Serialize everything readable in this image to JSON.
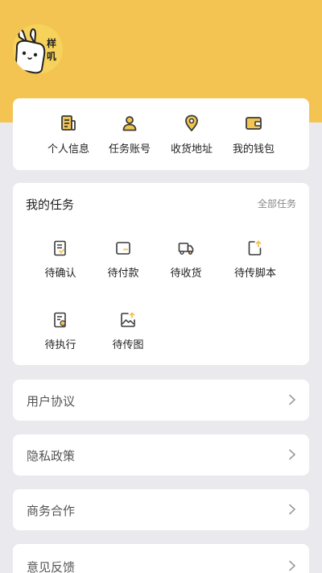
{
  "profile": {
    "avatar_text": "样叽",
    "avatar_text_line1": "样",
    "avatar_text_line2": "叽"
  },
  "quick_actions": [
    {
      "label": "个人信息",
      "icon": "document-icon"
    },
    {
      "label": "任务账号",
      "icon": "user-icon"
    },
    {
      "label": "收货地址",
      "icon": "location-pin-icon"
    },
    {
      "label": "我的钱包",
      "icon": "wallet-icon"
    }
  ],
  "tasks": {
    "title": "我的任务",
    "all_label": "全部任务",
    "items": [
      {
        "label": "待确认",
        "icon": "confirm-doc-icon"
      },
      {
        "label": "待付款",
        "icon": "payment-card-icon"
      },
      {
        "label": "待收货",
        "icon": "truck-icon"
      },
      {
        "label": "待传脚本",
        "icon": "upload-script-icon"
      },
      {
        "label": "待执行",
        "icon": "execute-doc-icon"
      },
      {
        "label": "待传图",
        "icon": "upload-image-icon"
      }
    ]
  },
  "menu": [
    {
      "label": "用户协议"
    },
    {
      "label": "隐私政策"
    },
    {
      "label": "商务合作"
    },
    {
      "label": "意见反馈"
    }
  ],
  "colors": {
    "accent": "#f3c452",
    "icon_dark": "#3a3a3a",
    "background": "#e9e9ee"
  }
}
